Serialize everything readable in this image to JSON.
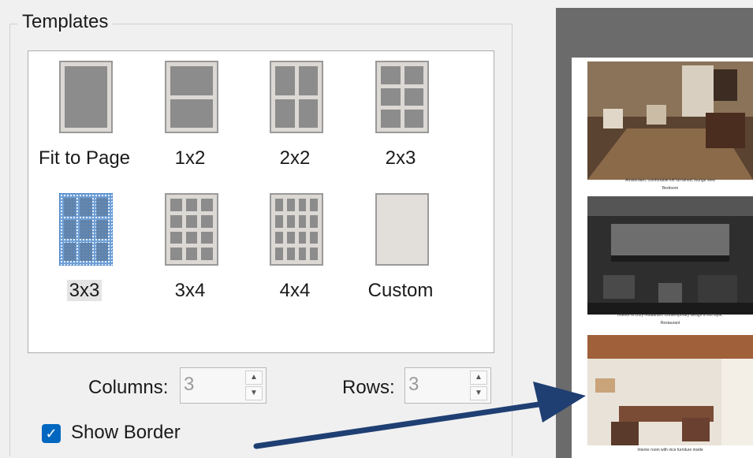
{
  "group": {
    "title": "Templates"
  },
  "templates": [
    {
      "label": "Fit to Page",
      "cols": 1,
      "rows": 1
    },
    {
      "label": "1x2",
      "cols": 1,
      "rows": 2
    },
    {
      "label": "2x2",
      "cols": 2,
      "rows": 2
    },
    {
      "label": "2x3",
      "cols": 2,
      "rows": 3
    },
    {
      "label": "3x3",
      "cols": 3,
      "rows": 3,
      "selected": true
    },
    {
      "label": "3x4",
      "cols": 3,
      "rows": 4
    },
    {
      "label": "4x4",
      "cols": 4,
      "rows": 4
    },
    {
      "label": "Custom",
      "cols": 0,
      "rows": 0
    }
  ],
  "columns": {
    "label": "Columns:",
    "value": "3"
  },
  "rows": {
    "label": "Rows:",
    "value": "3"
  },
  "show_border": {
    "label": "Show Border",
    "checked": true
  },
  "preview": {
    "captions": [
      "Amsterdam, comfortable loft furnished, lounge view",
      "Bedroom",
      "Interior of cozy restaurant. Contemporary design in loft style,",
      "Restaurant",
      "Interior room with nice furniture inside"
    ]
  },
  "colors": {
    "accent": "#0067c0",
    "selection": "#2f76c8",
    "arrow": "#1f3f73"
  }
}
